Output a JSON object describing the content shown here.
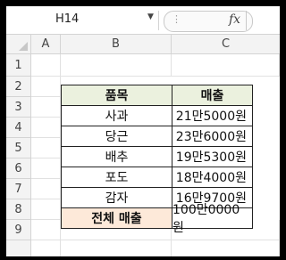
{
  "formula_bar": {
    "name_box": "H14",
    "fx_label": "fx"
  },
  "columns": [
    "A",
    "B",
    "C"
  ],
  "rows": [
    "1",
    "2",
    "3",
    "4",
    "5",
    "6",
    "7",
    "8",
    "9"
  ],
  "table": {
    "headers": [
      "품목",
      "매출"
    ],
    "items": [
      {
        "item": "사과",
        "sales": "21만5000원"
      },
      {
        "item": "당근",
        "sales": "23만6000원"
      },
      {
        "item": "배추",
        "sales": "19만5300원"
      },
      {
        "item": "포도",
        "sales": "18만4000원"
      },
      {
        "item": "감자",
        "sales": "16만9700원"
      }
    ],
    "total": {
      "label": "전체 매출",
      "sales": "100만0000원"
    }
  },
  "colors": {
    "header_fill": "#ebf1de",
    "total_fill": "#fde9d9",
    "frame_background": "#000000"
  }
}
